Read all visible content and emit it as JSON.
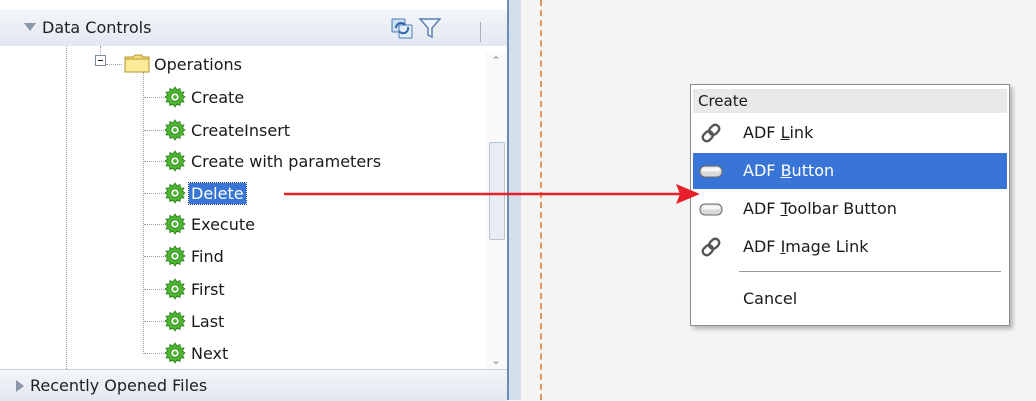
{
  "data_controls_panel": {
    "title": "Data Controls",
    "header_icons": [
      "refresh-icon",
      "filter-icon"
    ],
    "tree": {
      "folder": "Operations",
      "items": [
        {
          "label": "Create"
        },
        {
          "label": "CreateInsert"
        },
        {
          "label": "Create with parameters"
        },
        {
          "label": "Delete",
          "selected": true
        },
        {
          "label": "Execute"
        },
        {
          "label": "Find"
        },
        {
          "label": "First"
        },
        {
          "label": "Last"
        },
        {
          "label": "Next"
        }
      ]
    }
  },
  "recent_files_panel": {
    "title": "Recently Opened Files"
  },
  "context_menu": {
    "header": "Create",
    "items": [
      {
        "pre": "ADF ",
        "accel": "L",
        "post": "ink",
        "icon": "link-icon"
      },
      {
        "pre": "ADF ",
        "accel": "B",
        "post": "utton",
        "icon": "button-icon",
        "highlighted": true
      },
      {
        "pre": "ADF ",
        "accel": "T",
        "post": "oolbar Button",
        "icon": "button-icon"
      },
      {
        "pre": "ADF ",
        "accel": "I",
        "post": "mage Link",
        "icon": "link-icon"
      }
    ],
    "cancel": "Cancel"
  },
  "colors": {
    "selection": "#3875d7",
    "arrow": "#e8202a",
    "divider": "#e8955a",
    "gear": "#3fae2a"
  }
}
